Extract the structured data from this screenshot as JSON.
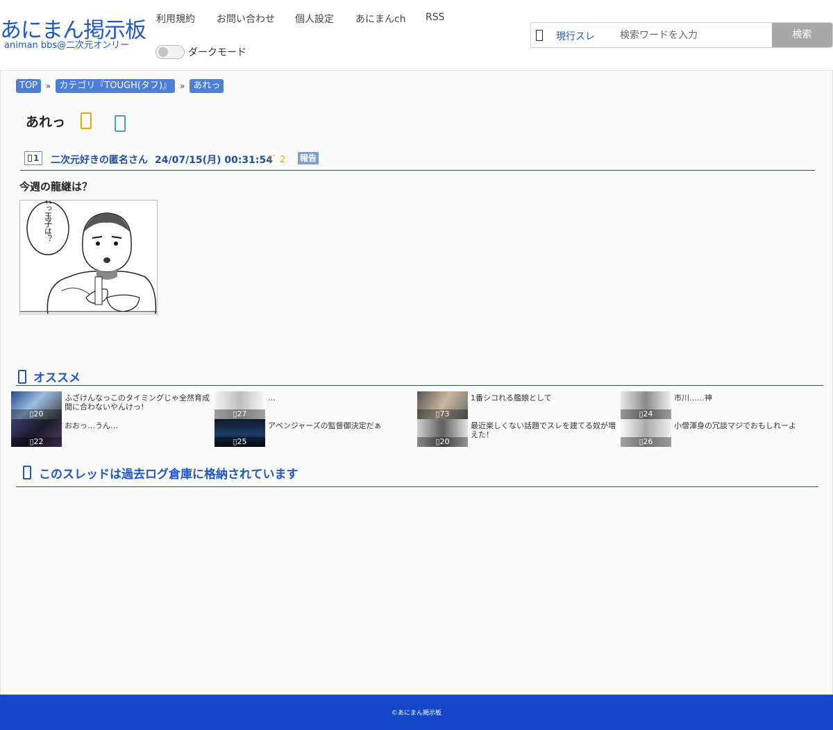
{
  "header": {
    "logo_title": "あにまん掲示板",
    "logo_subtitle": "animan bbs@二次元オンリー",
    "nav": [
      "利用規約",
      "お問い合わせ",
      "個人設定",
      "あにまんch",
      "RSS"
    ],
    "dark_mode_label": "ダークモード",
    "search": {
      "scope_label": "現行スレ",
      "placeholder": "検索ワードを入力",
      "button_label": "検索"
    }
  },
  "breadcrumb": [
    "TOP",
    "カテゴリ『TOUGH(タフ)』",
    "あれっ"
  ],
  "breadcrumb_separator": "»",
  "thread": {
    "title": "あれっ",
    "post": {
      "number": "1",
      "name": "二次元好きの匿名さん",
      "date": "24/07/15(月) 00:31:54",
      "id": "2",
      "report_label": "報告",
      "body": "今週の龍継は？",
      "image_caption": "あれっ玉子は？"
    }
  },
  "recommend": {
    "heading": "オススメ",
    "items": [
      {
        "title": "ふざけんなっこのタイミングじゃ全然育成間に合わないやんけっ!",
        "count": "20"
      },
      {
        "title": "…",
        "count": "27"
      },
      {
        "title": "1番シコれる艦娘として",
        "count": "73"
      },
      {
        "title": "市川……神",
        "count": "24"
      },
      {
        "title": "おおっ…うん…",
        "count": "22"
      },
      {
        "title": "アベンジャーズの監督御決定だぁ",
        "count": "25"
      },
      {
        "title": "最近楽しくない話題でスレを建てる奴が増えた！",
        "count": "20"
      },
      {
        "title": "小僧渾身の冗談マジでおもしれーよ",
        "count": "26"
      }
    ]
  },
  "archive_notice": "このスレッドは過去ログ倉庫に格納されています",
  "footer": {
    "copyright": "©あにまん掲示板"
  },
  "colors": {
    "brand_blue": "#1f58c6",
    "footer_blue": "#1647c9",
    "crumb_blue": "#4d7fd6",
    "fav_yellow": "#e5a719",
    "share_blue": "#4d9ad8"
  }
}
